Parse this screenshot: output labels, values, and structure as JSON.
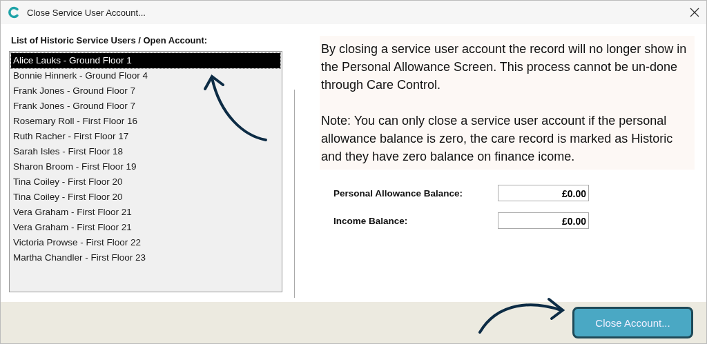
{
  "window": {
    "title": "Close Service User Account..."
  },
  "list": {
    "label": "List of Historic Service Users / Open Account:",
    "items": [
      {
        "text": "Alice Lauks - Ground Floor 1",
        "selected": true
      },
      {
        "text": "Bonnie Hinnerk - Ground Floor 4",
        "selected": false
      },
      {
        "text": "Frank Jones - Ground Floor 7",
        "selected": false
      },
      {
        "text": "Frank Jones - Ground Floor 7",
        "selected": false
      },
      {
        "text": "Rosemary Roll - First Floor 16",
        "selected": false
      },
      {
        "text": "Ruth Racher - First Floor 17",
        "selected": false
      },
      {
        "text": "Sarah Isles - First Floor 18",
        "selected": false
      },
      {
        "text": "Sharon Broom - First Floor 19",
        "selected": false
      },
      {
        "text": "Tina Coiley - First Floor 20",
        "selected": false
      },
      {
        "text": "Tina Coiley - First Floor 20",
        "selected": false
      },
      {
        "text": "Vera Graham - First Floor 21",
        "selected": false
      },
      {
        "text": "Vera Graham - First Floor 21",
        "selected": false
      },
      {
        "text": "Victoria Prowse - First Floor 22",
        "selected": false
      },
      {
        "text": "Martha Chandler - First Floor 23",
        "selected": false
      }
    ]
  },
  "info": [
    "By closing a service user account the record will no longer show in the Personal Allowance Screen.  This process cannot be un-done through Care Control.",
    "Note: You can only close a service user account if the personal allowance balance is zero, the care record is marked as Historic and they have zero balance on finance icome."
  ],
  "fields": [
    {
      "label": "Personal Allowance Balance:",
      "value": "£0.00"
    },
    {
      "label": "Income Balance:",
      "value": "£0.00"
    }
  ],
  "buttons": [
    "Close Account..."
  ]
}
